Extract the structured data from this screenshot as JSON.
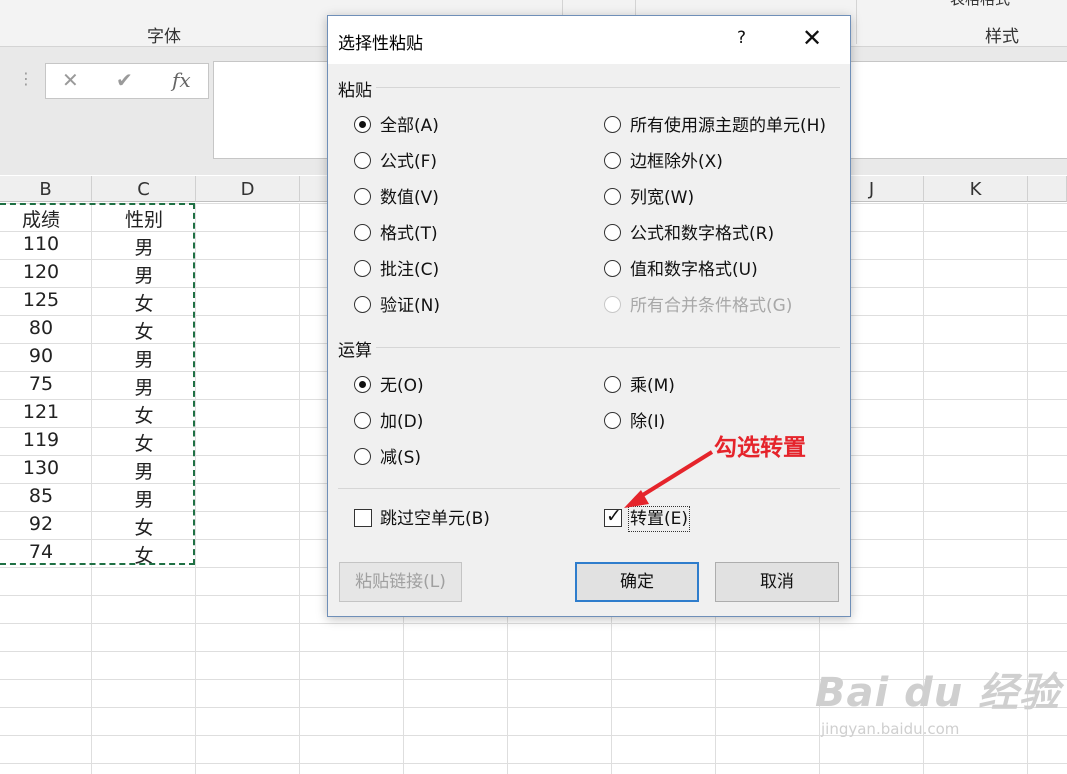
{
  "ribbon": {
    "groups": [
      "字体",
      "样式"
    ],
    "truncated_top": "表格格式"
  },
  "formula_bar": {
    "cancel_glyph": "✕",
    "enter_glyph": "✔",
    "fx_label": "fx",
    "value": ""
  },
  "sheet": {
    "columns": [
      "B",
      "C",
      "D",
      "J",
      "K"
    ],
    "rows": [
      [
        "成绩",
        "性别"
      ],
      [
        "110",
        "男"
      ],
      [
        "120",
        "男"
      ],
      [
        "125",
        "女"
      ],
      [
        "80",
        "女"
      ],
      [
        "90",
        "男"
      ],
      [
        "75",
        "男"
      ],
      [
        "121",
        "女"
      ],
      [
        "119",
        "女"
      ],
      [
        "130",
        "男"
      ],
      [
        "85",
        "男"
      ],
      [
        "92",
        "女"
      ],
      [
        "74",
        "女"
      ]
    ]
  },
  "dialog": {
    "title": "选择性粘贴",
    "help": "?",
    "close": "✕",
    "paste_section": "粘贴",
    "paste_options": [
      {
        "label": "全部(A)",
        "checked": true,
        "disabled": false
      },
      {
        "label": "公式(F)",
        "checked": false,
        "disabled": false
      },
      {
        "label": "数值(V)",
        "checked": false,
        "disabled": false
      },
      {
        "label": "格式(T)",
        "checked": false,
        "disabled": false
      },
      {
        "label": "批注(C)",
        "checked": false,
        "disabled": false
      },
      {
        "label": "验证(N)",
        "checked": false,
        "disabled": false
      },
      {
        "label": "所有使用源主题的单元(H)",
        "checked": false,
        "disabled": false
      },
      {
        "label": "边框除外(X)",
        "checked": false,
        "disabled": false
      },
      {
        "label": "列宽(W)",
        "checked": false,
        "disabled": false
      },
      {
        "label": "公式和数字格式(R)",
        "checked": false,
        "disabled": false
      },
      {
        "label": "值和数字格式(U)",
        "checked": false,
        "disabled": false
      },
      {
        "label": "所有合并条件格式(G)",
        "checked": false,
        "disabled": true
      }
    ],
    "operation_section": "运算",
    "operation_options": [
      {
        "label": "无(O)",
        "checked": true
      },
      {
        "label": "加(D)",
        "checked": false
      },
      {
        "label": "减(S)",
        "checked": false
      },
      {
        "label": "乘(M)",
        "checked": false
      },
      {
        "label": "除(I)",
        "checked": false
      }
    ],
    "skip_blanks": {
      "label": "跳过空单元(B)",
      "checked": false
    },
    "transpose": {
      "label": "转置(E)",
      "checked": true
    },
    "paste_link_button": "粘贴链接(L)",
    "ok_button": "确定",
    "cancel_button": "取消"
  },
  "annotation": {
    "text": "勾选转置",
    "color": "#e5242b"
  },
  "watermark": {
    "main": "Bai du 经验",
    "sub": "jingyan.baidu.com"
  },
  "colors": {
    "marquee": "#1f7044",
    "dialog_default_border": "#2f7dcc"
  }
}
